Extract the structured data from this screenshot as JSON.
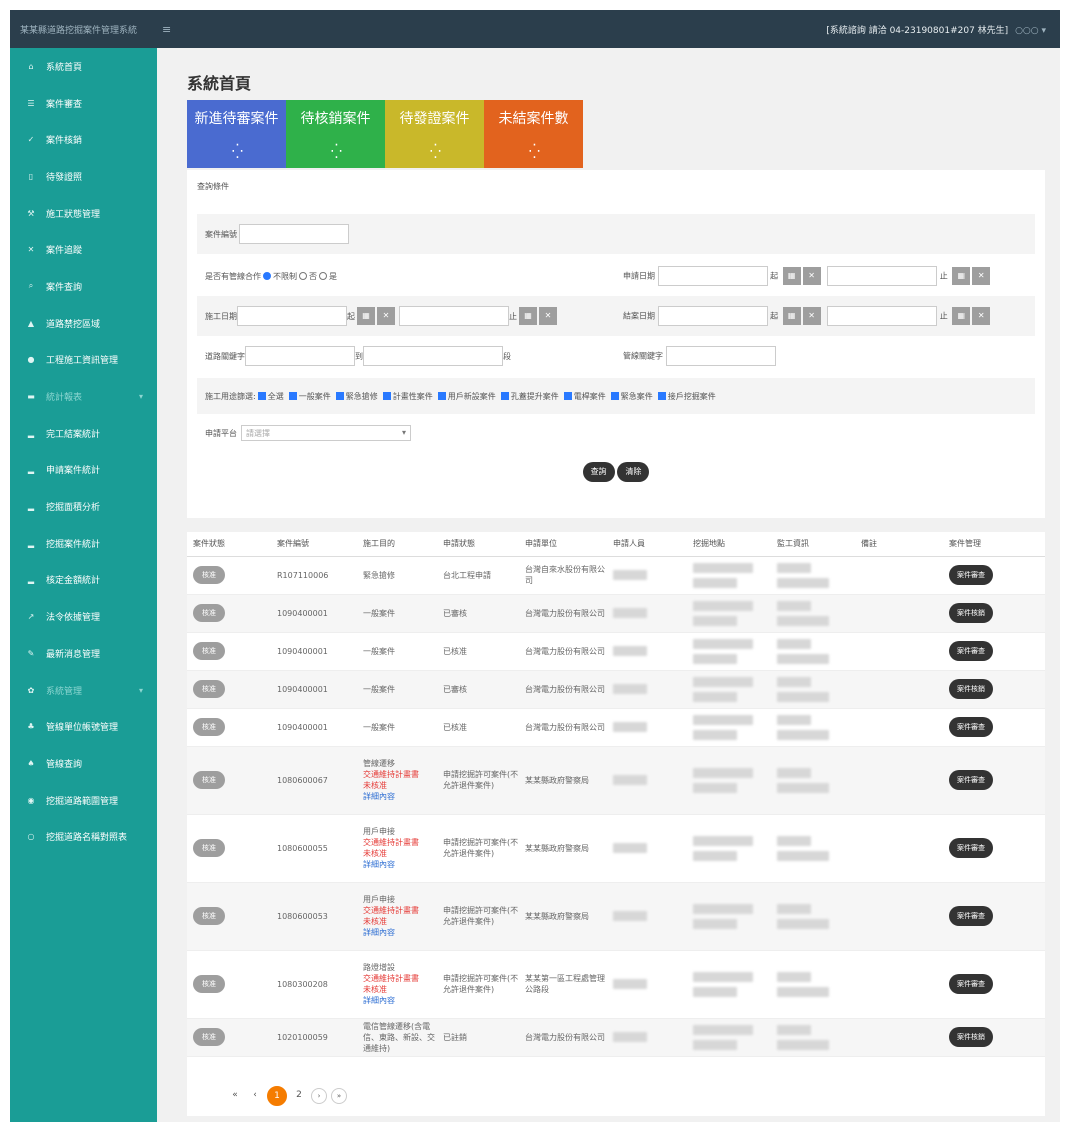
{
  "header": {
    "brand": "某某縣道路挖掘案件管理系統",
    "menu_icon": "hamburger-icon",
    "contact": "[系統諮詢 請洽 04-23190801#207 林先生]",
    "user": "○○○ ▾"
  },
  "sidebar": {
    "items": [
      {
        "label": "系統首頁",
        "icon": "home-icon"
      },
      {
        "label": "案件審查",
        "icon": "list-icon"
      },
      {
        "label": "案件核銷",
        "icon": "check-icon"
      },
      {
        "label": "待發證照",
        "icon": "doc-icon"
      },
      {
        "label": "施工狀態管理",
        "icon": "tool-icon"
      },
      {
        "label": "案件追蹤",
        "icon": "track-icon"
      },
      {
        "label": "案件查詢",
        "icon": "search-icon"
      },
      {
        "label": "道路禁挖區域",
        "icon": "warning-icon"
      },
      {
        "label": "工程施工資訊管理",
        "icon": "info-icon"
      },
      {
        "label": "統計報表",
        "icon": "chart-icon",
        "group": true
      },
      {
        "label": "完工結案統計",
        "icon": "bar-icon"
      },
      {
        "label": "申請案件統計",
        "icon": "bar-icon"
      },
      {
        "label": "挖掘面積分析",
        "icon": "bar-icon"
      },
      {
        "label": "挖掘案件統計",
        "icon": "bar-icon"
      },
      {
        "label": "核定金額統計",
        "icon": "bar-icon"
      },
      {
        "label": "法令依據管理",
        "icon": "law-icon"
      },
      {
        "label": "最新消息管理",
        "icon": "news-icon"
      },
      {
        "label": "系統管理",
        "icon": "gear-icon",
        "group": true
      },
      {
        "label": "管線單位帳號管理",
        "icon": "users-icon"
      },
      {
        "label": "管線查詢",
        "icon": "pipe-icon"
      },
      {
        "label": "挖掘道路範圍管理",
        "icon": "road-icon"
      },
      {
        "label": "挖掘道路名稱對照表",
        "icon": "table-icon"
      }
    ]
  },
  "page": {
    "title": "系統首頁",
    "tiles": [
      {
        "label": "新進待審案件",
        "color": "#4a6bd0"
      },
      {
        "label": "待核銷案件",
        "color": "#2fb14a"
      },
      {
        "label": "待發證案件",
        "color": "#c9b82a"
      },
      {
        "label": "未結案件數",
        "color": "#e2631e"
      }
    ],
    "spinner": "⁛"
  },
  "search": {
    "title": "查詢條件",
    "case_no_label": "案件編號",
    "merge_label": "是否有管線合作",
    "merge_opts": [
      "不限制",
      "否",
      "是"
    ],
    "apply_date_label": "申請日期",
    "from": "起",
    "to": "止",
    "start_date_label": "施工日期",
    "end_date_label": "結案日期",
    "road_label": "道路關鍵字",
    "road_mid": "到",
    "road_end": "段",
    "pipe_label": "管線關鍵字",
    "filter_label": "施工用途篩選:",
    "filters": [
      "全選",
      "一般案件",
      "緊急搶修",
      "計畫性案件",
      "用戶新設案件",
      "孔蓋提升案件",
      "電桿案件",
      "緊急案件",
      "接戶挖掘案件"
    ],
    "platform_label": "申請平台",
    "platform_placeholder": "請選擇",
    "btn_search": "查詢",
    "btn_reset": "清除"
  },
  "table": {
    "headers": [
      "案件狀態",
      "案件編號",
      "施工目的",
      "申請狀態",
      "申請單位",
      "申請人員",
      "挖掘地點",
      "監工資訊",
      "備註",
      "案件管理"
    ],
    "rows": [
      {
        "status": "核准",
        "no": "R107110006",
        "purpose": [
          "緊急搶修"
        ],
        "state": "台北工程申請",
        "unit": "台灣自來水股份有限公司",
        "action": "案件審查"
      },
      {
        "status": "核准",
        "no": "1090400001",
        "purpose": [
          "一般案件"
        ],
        "state": "已審核",
        "unit": "台灣電力股份有限公司",
        "action": "案件核銷"
      },
      {
        "status": "核准",
        "no": "1090400001",
        "purpose": [
          "一般案件"
        ],
        "state": "已核准",
        "unit": "台灣電力股份有限公司",
        "action": "案件審查"
      },
      {
        "status": "核准",
        "no": "1090400001",
        "purpose": [
          "一般案件"
        ],
        "state": "已審核",
        "unit": "台灣電力股份有限公司",
        "action": "案件核銷"
      },
      {
        "status": "核准",
        "no": "1090400001",
        "purpose": [
          "一般案件"
        ],
        "state": "已核准",
        "unit": "台灣電力股份有限公司",
        "action": "案件審查"
      },
      {
        "status": "核准",
        "no": "1080600067",
        "purpose": [
          "管線遷移",
          "交通維持計畫書",
          "未核准",
          "詳細內容"
        ],
        "state": "申請挖掘許可案件(不允許退件案件)",
        "unit": "某某縣政府警察局",
        "action": "案件審查"
      },
      {
        "status": "核准",
        "no": "1080600055",
        "purpose": [
          "用戶申接",
          "交通維持計畫書",
          "未核准",
          "詳細內容"
        ],
        "state": "申請挖掘許可案件(不允許退件案件)",
        "unit": "某某縣政府警察局",
        "action": "案件審查"
      },
      {
        "status": "核准",
        "no": "1080600053",
        "purpose": [
          "用戶申接",
          "交通維持計畫書",
          "未核准",
          "詳細內容"
        ],
        "state": "申請挖掘許可案件(不允許退件案件)",
        "unit": "某某縣政府警察局",
        "action": "案件審查"
      },
      {
        "status": "核准",
        "no": "1080300208",
        "purpose": [
          "路燈增設",
          "交通維持計畫書",
          "未核准",
          "詳細內容"
        ],
        "state": "申請挖掘許可案件(不允許退件案件)",
        "unit": "某某第一區工程處管理公路段",
        "action": "案件審查"
      },
      {
        "status": "核准",
        "no": "1020100059",
        "purpose": [
          "電信管線遷移(含電信、東路、新設、交通維持)"
        ],
        "state": "已註銷",
        "unit": "台灣電力股份有限公司",
        "action": "案件核銷"
      }
    ]
  },
  "pager": {
    "first": "«",
    "prev": "‹",
    "current": "1",
    "next_page": "2",
    "next": "›",
    "last": "»"
  }
}
